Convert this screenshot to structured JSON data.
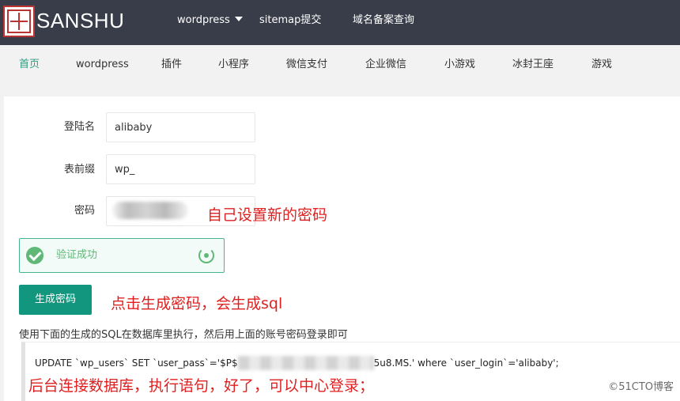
{
  "header": {
    "brand": "SANSHU",
    "nav": [
      {
        "label": "wordpress"
      },
      {
        "label": "sitemap提交"
      },
      {
        "label": "域名备案查询"
      }
    ]
  },
  "subnav": {
    "items": [
      "首页",
      "wordpress",
      "插件",
      "小程序",
      "微信支付",
      "企业微信",
      "小游戏",
      "冰封王座",
      "游戏"
    ],
    "active": "首页"
  },
  "form": {
    "login_label": "登陆名",
    "login_value": "alibaby",
    "prefix_label": "表前缀",
    "prefix_value": "wp_",
    "password_label": "密码",
    "verify_text": "验证成功",
    "generate_button": "生成密码",
    "hint": "使用下面的生成的SQL在数据库里执行，然后用上面的账号密码登录即可",
    "sql_prefix": "UPDATE `wp_users` SET `user_pass`='$P$",
    "sql_suffix": "5u8.MS.' where `user_login`='alibaby';"
  },
  "annotations": {
    "password_note": "自己设置新的密码",
    "button_note": "点击生成密码，会生成sql",
    "db_note": "后台连接数据库，执行语句，好了，可以中心登录；"
  },
  "watermark": "©51CTO博客",
  "colors": {
    "topbar": "#393d49",
    "accent": "#12977e",
    "success": "#5fb878",
    "annotation": "#e02020"
  }
}
